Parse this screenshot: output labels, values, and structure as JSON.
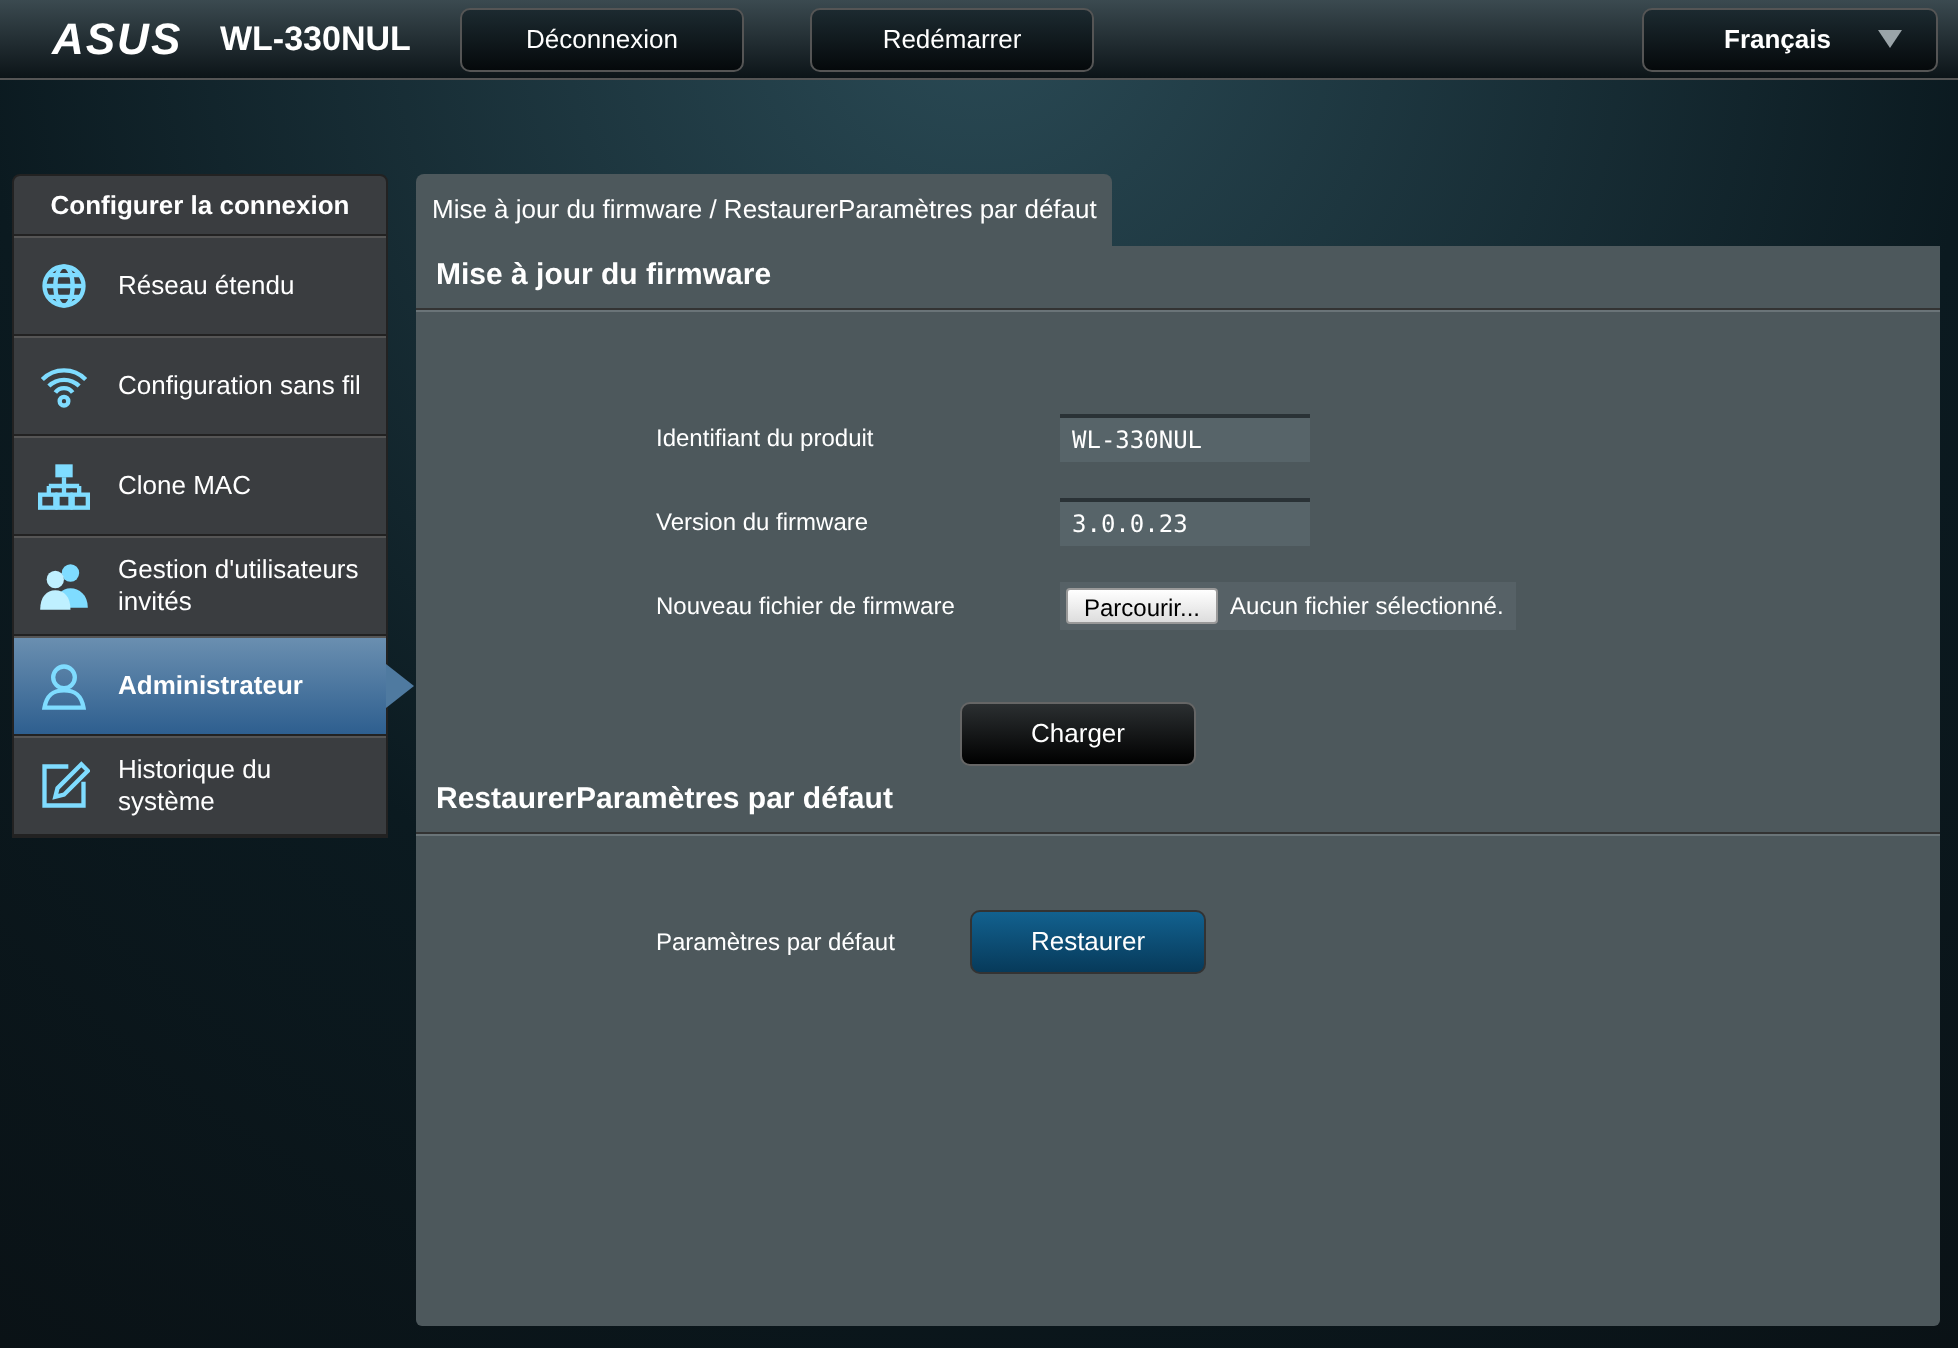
{
  "header": {
    "logo": "ASUS",
    "model": "WL-330NUL",
    "buttons": [
      "Déconnexion",
      "Redémarrer"
    ],
    "language": {
      "value": "Français"
    }
  },
  "sidebar": {
    "title": "Configurer la connexion",
    "items": [
      {
        "label": "Réseau étendu",
        "kind": "globe",
        "selected": false
      },
      {
        "label": "Configuration sans fil",
        "kind": "wifi",
        "selected": false
      },
      {
        "label": "Clone MAC",
        "kind": "network",
        "selected": false
      },
      {
        "label": "Gestion d'utilisateurs invités",
        "kind": "users",
        "selected": false
      },
      {
        "label": "Administrateur",
        "kind": "person",
        "selected": true
      },
      {
        "label": "Historique du système",
        "kind": "edit",
        "selected": false
      }
    ]
  },
  "tabs": [
    {
      "label": "Mise à jour du firmware / RestaurerParamètres par défaut",
      "selected": true
    }
  ],
  "firmware": {
    "title": "Mise à jour du firmware",
    "fields": [
      {
        "label": "Identifiant du produit",
        "kind": "text",
        "value": "WL-330NUL"
      },
      {
        "label": "Version du firmware",
        "kind": "text",
        "value": "3.0.0.23"
      },
      {
        "label": "Nouveau fichier de firmware",
        "kind": "file",
        "button": "Parcourir...",
        "status": "Aucun fichier sélectionné."
      }
    ],
    "button": "Charger"
  },
  "restore": {
    "title": "RestaurerParamètres par défaut",
    "label": "Paramètres par défaut",
    "button": "Restaurer"
  }
}
